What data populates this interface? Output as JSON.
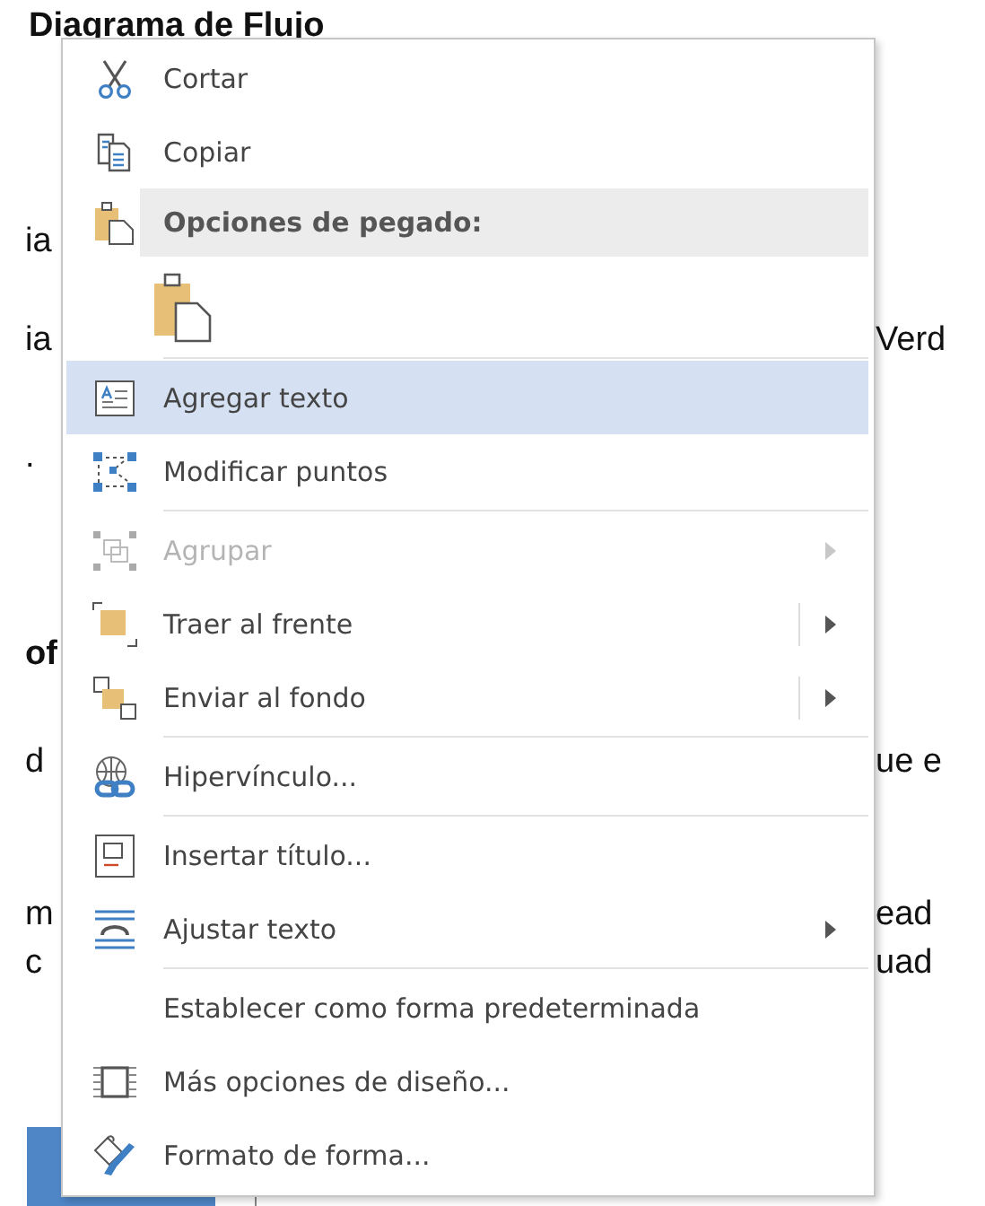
{
  "document": {
    "title": "Diagrama de Flujo",
    "lines": [
      {
        "left": "ia",
        "bold": false
      },
      {
        "left": "ia",
        "right": "Verd",
        "bold": false
      },
      {
        "left": ".",
        "bold": false
      },
      {
        "left": "of",
        "bold": true
      },
      {
        "left": "d",
        "right": "ue e",
        "bold": false
      },
      {
        "left": "m",
        "right": "ead",
        "bold": false
      },
      {
        "left": "c",
        "right": "uad",
        "bold": false
      }
    ]
  },
  "context_menu": {
    "items": [
      {
        "kind": "command",
        "label": "Cortar",
        "selected": false,
        "disabled": false,
        "submenu": false,
        "split": false
      },
      {
        "kind": "command",
        "label": "Copiar",
        "selected": false,
        "disabled": false,
        "submenu": false,
        "split": false
      },
      {
        "kind": "header",
        "label": "Opciones de pegado:"
      },
      {
        "kind": "paste"
      },
      {
        "kind": "separator"
      },
      {
        "kind": "command",
        "label": "Agregar texto",
        "selected": true,
        "disabled": false,
        "submenu": false,
        "split": false
      },
      {
        "kind": "command",
        "label": "Modificar puntos",
        "selected": false,
        "disabled": false,
        "submenu": false,
        "split": false
      },
      {
        "kind": "separator"
      },
      {
        "kind": "command",
        "label": "Agrupar",
        "selected": false,
        "disabled": true,
        "submenu": true,
        "split": false
      },
      {
        "kind": "command",
        "label": "Traer al frente",
        "selected": false,
        "disabled": false,
        "submenu": true,
        "split": true
      },
      {
        "kind": "command",
        "label": "Enviar al fondo",
        "selected": false,
        "disabled": false,
        "submenu": true,
        "split": true
      },
      {
        "kind": "separator"
      },
      {
        "kind": "command",
        "label": "Hipervínculo...",
        "selected": false,
        "disabled": false,
        "submenu": false,
        "split": false
      },
      {
        "kind": "separator"
      },
      {
        "kind": "command",
        "label": "Insertar título...",
        "selected": false,
        "disabled": false,
        "submenu": false,
        "split": false
      },
      {
        "kind": "command",
        "label": "Ajustar texto",
        "selected": false,
        "disabled": false,
        "submenu": true,
        "split": false
      },
      {
        "kind": "separator"
      },
      {
        "kind": "command",
        "label": "Establecer como forma predeterminada",
        "selected": false,
        "disabled": false,
        "submenu": false,
        "split": false
      },
      {
        "kind": "command",
        "label": "Más opciones de diseño...",
        "selected": false,
        "disabled": false,
        "submenu": false,
        "split": false
      },
      {
        "kind": "command",
        "label": "Formato de forma...",
        "selected": false,
        "disabled": false,
        "submenu": false,
        "split": false
      }
    ]
  }
}
